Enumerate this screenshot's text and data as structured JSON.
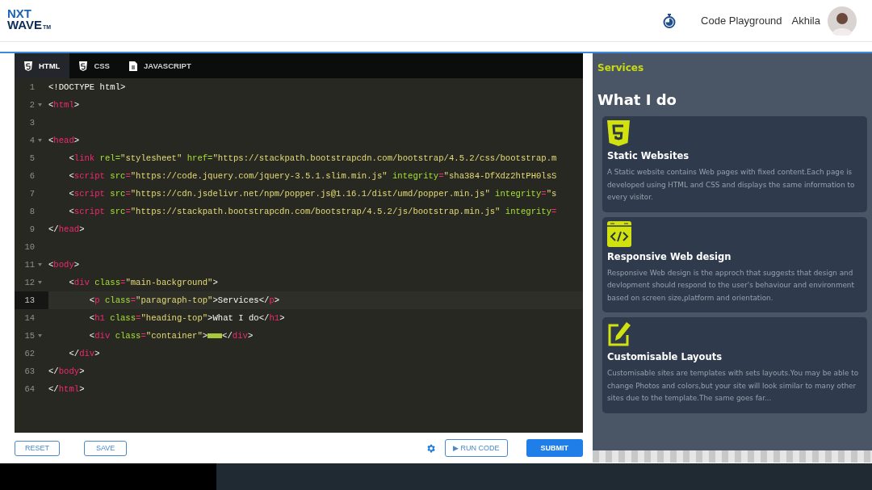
{
  "header": {
    "logo_top": "NXT",
    "logo_bottom": "WAVE",
    "logo_mark": "TM",
    "nav_link": "Code Playground",
    "user_name": "Akhila"
  },
  "tabs": [
    {
      "label": "HTML",
      "kind": "html",
      "selected": true
    },
    {
      "label": "CSS",
      "kind": "css",
      "selected": false
    },
    {
      "label": "JAVASCRIPT",
      "kind": "js",
      "selected": false
    }
  ],
  "code_lines": [
    {
      "number": "1",
      "foldable": false,
      "active": false,
      "tokens": [
        {
          "kind": "text",
          "text": "<!DOCTYPE html>"
        }
      ]
    },
    {
      "number": "2",
      "foldable": true,
      "active": false,
      "tokens": [
        {
          "kind": "punct",
          "text": "<"
        },
        {
          "kind": "tag",
          "text": "html"
        },
        {
          "kind": "punct",
          "text": ">"
        }
      ]
    },
    {
      "number": "3",
      "foldable": false,
      "active": false
    },
    {
      "number": "4",
      "foldable": true,
      "active": false,
      "tokens": [
        {
          "kind": "punct",
          "text": "<"
        },
        {
          "kind": "tag",
          "text": "head"
        },
        {
          "kind": "punct",
          "text": ">"
        }
      ]
    },
    {
      "number": "5",
      "foldable": false,
      "active": false,
      "tokens": [
        {
          "kind": "punct",
          "text": "    <"
        },
        {
          "kind": "tag",
          "text": "link"
        },
        {
          "kind": "attr",
          "text": " rel="
        },
        {
          "kind": "str",
          "text": "\"stylesheet\""
        },
        {
          "kind": "attr",
          "text": " href="
        },
        {
          "kind": "str",
          "text": "\"https://stackpath.bootstrapcdn.com/bootstrap/4.5.2/css/bootstrap.m"
        }
      ]
    },
    {
      "number": "6",
      "foldable": false,
      "active": false,
      "tokens": [
        {
          "kind": "punct",
          "text": "    <"
        },
        {
          "kind": "tag",
          "text": "script"
        },
        {
          "kind": "attr",
          "text": " src"
        },
        {
          "kind": "tag",
          "text": "="
        },
        {
          "kind": "str",
          "text": "\"https://code.jquery.com/jquery-3.5.1.slim.min.js\""
        },
        {
          "kind": "attr",
          "text": " integrity"
        },
        {
          "kind": "tag",
          "text": "="
        },
        {
          "kind": "str",
          "text": "\"sha384-DfXdz2htPH0lsS"
        }
      ]
    },
    {
      "number": "7",
      "foldable": false,
      "active": false,
      "tokens": [
        {
          "kind": "punct",
          "text": "    <"
        },
        {
          "kind": "tag",
          "text": "script"
        },
        {
          "kind": "attr",
          "text": " src"
        },
        {
          "kind": "tag",
          "text": "="
        },
        {
          "kind": "str",
          "text": "\"https://cdn.jsdelivr.net/npm/popper.js@1.16.1/dist/umd/popper.min.js\""
        },
        {
          "kind": "attr",
          "text": " integrity"
        },
        {
          "kind": "tag",
          "text": "="
        },
        {
          "kind": "str",
          "text": "\"s"
        }
      ]
    },
    {
      "number": "8",
      "foldable": false,
      "active": false,
      "tokens": [
        {
          "kind": "punct",
          "text": "    <"
        },
        {
          "kind": "tag",
          "text": "script"
        },
        {
          "kind": "attr",
          "text": " src"
        },
        {
          "kind": "tag",
          "text": "="
        },
        {
          "kind": "str",
          "text": "\"https://stackpath.bootstrapcdn.com/bootstrap/4.5.2/js/bootstrap.min.js\""
        },
        {
          "kind": "attr",
          "text": " integrity"
        },
        {
          "kind": "tag",
          "text": "="
        }
      ]
    },
    {
      "number": "9",
      "foldable": false,
      "active": false,
      "tokens": [
        {
          "kind": "punct",
          "text": "</"
        },
        {
          "kind": "tag",
          "text": "head"
        },
        {
          "kind": "punct",
          "text": ">"
        }
      ]
    },
    {
      "number": "10",
      "foldable": false,
      "active": false
    },
    {
      "number": "11",
      "foldable": true,
      "active": false,
      "tokens": [
        {
          "kind": "punct",
          "text": "<"
        },
        {
          "kind": "tag",
          "text": "body"
        },
        {
          "kind": "punct",
          "text": ">"
        }
      ]
    },
    {
      "number": "12",
      "foldable": true,
      "active": false,
      "tokens": [
        {
          "kind": "punct",
          "text": "    <"
        },
        {
          "kind": "tag",
          "text": "div"
        },
        {
          "kind": "attr",
          "text": " class"
        },
        {
          "kind": "tag",
          "text": "="
        },
        {
          "kind": "str",
          "text": "\"main-background\""
        },
        {
          "kind": "punct",
          "text": ">"
        }
      ]
    },
    {
      "number": "13",
      "foldable": false,
      "active": true,
      "tokens": [
        {
          "kind": "punct",
          "text": "        <"
        },
        {
          "kind": "tag",
          "text": "p"
        },
        {
          "kind": "attr",
          "text": " class"
        },
        {
          "kind": "tag",
          "text": "="
        },
        {
          "kind": "str",
          "text": "\"paragraph-top\""
        },
        {
          "kind": "punct",
          "text": ">Services</"
        },
        {
          "kind": "tag",
          "text": "p"
        },
        {
          "kind": "punct",
          "text": ">"
        }
      ]
    },
    {
      "number": "14",
      "foldable": false,
      "active": false,
      "tokens": [
        {
          "kind": "punct",
          "text": "        <"
        },
        {
          "kind": "tag",
          "text": "h1"
        },
        {
          "kind": "attr",
          "text": " class"
        },
        {
          "kind": "tag",
          "text": "="
        },
        {
          "kind": "str",
          "text": "\"heading-top\""
        },
        {
          "kind": "punct",
          "text": ">What I do</"
        },
        {
          "kind": "tag",
          "text": "h1"
        },
        {
          "kind": "punct",
          "text": ">"
        }
      ]
    },
    {
      "number": "15",
      "foldable": true,
      "active": false,
      "tokens": [
        {
          "kind": "punct",
          "text": "        <"
        },
        {
          "kind": "tag",
          "text": "div"
        },
        {
          "kind": "attr",
          "text": " class"
        },
        {
          "kind": "tag",
          "text": "="
        },
        {
          "kind": "str",
          "text": "\"container\""
        },
        {
          "kind": "punct",
          "text": ">"
        },
        {
          "kind": "folded"
        },
        {
          "kind": "punct",
          "text": "</"
        },
        {
          "kind": "tag",
          "text": "div"
        },
        {
          "kind": "punct",
          "text": ">"
        }
      ]
    },
    {
      "number": "62",
      "foldable": false,
      "active": false,
      "tokens": [
        {
          "kind": "punct",
          "text": "    </"
        },
        {
          "kind": "tag",
          "text": "div"
        },
        {
          "kind": "punct",
          "text": ">"
        }
      ]
    },
    {
      "number": "63",
      "foldable": false,
      "active": false,
      "tokens": [
        {
          "kind": "punct",
          "text": "</"
        },
        {
          "kind": "tag",
          "text": "body"
        },
        {
          "kind": "punct",
          "text": ">"
        }
      ]
    },
    {
      "number": "64",
      "foldable": false,
      "active": false,
      "tokens": [
        {
          "kind": "punct",
          "text": "</"
        },
        {
          "kind": "tag",
          "text": "html"
        },
        {
          "kind": "punct",
          "text": ">"
        }
      ]
    }
  ],
  "buttons": {
    "reset": "RESET",
    "save": "SAVE",
    "run": "RUN CODE",
    "run_icon": "▶",
    "submit": "SUBMIT"
  },
  "preview": {
    "kicker": "Services",
    "heading": "What I do",
    "cards": [
      {
        "kind": "html5",
        "title": "Static Websites",
        "text": "A Static website contains Web pages with fixed content.Each page is developed using HTML and CSS and displays the same information to every visitor."
      },
      {
        "kind": "code",
        "title": "Responsive Web design",
        "text": "Responsive Web design is the approch that suggests that design and devlopment should respond to the user's behaviour and environment based on screen size,platform and orientation."
      },
      {
        "kind": "edit",
        "title": "Customisable Layouts",
        "text": "Customisable sites are templates with sets layouts.You may be able to change Photos and colors,but your site will look similar to many other sites due to the template.The same goes far..."
      }
    ]
  }
}
